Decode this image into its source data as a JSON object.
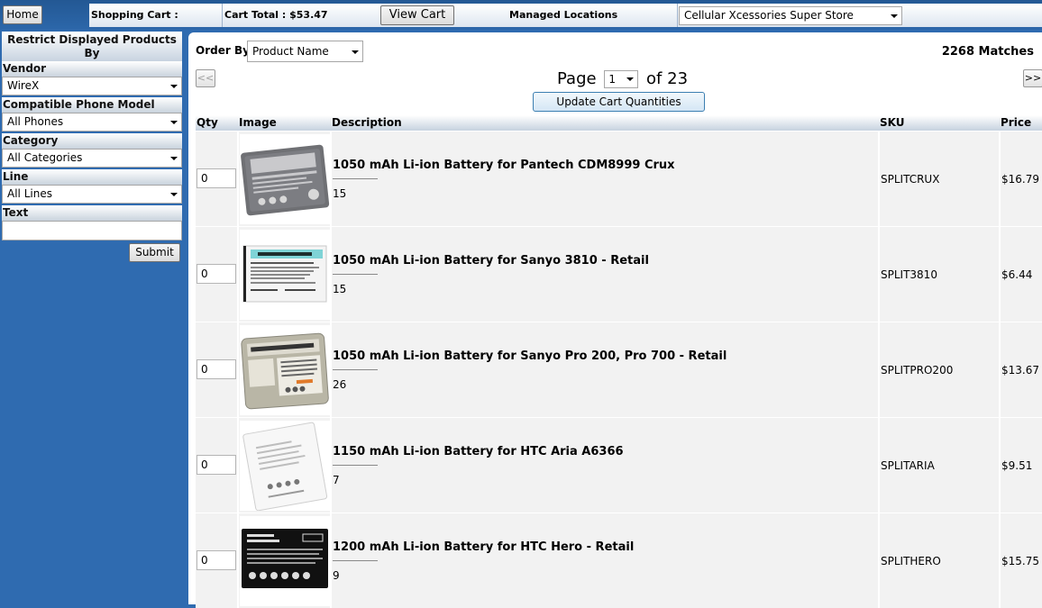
{
  "topbar": {
    "home_label": "Home",
    "shopping_cart_label": "Shopping Cart :",
    "cart_total_label": "Cart Total : $53.47",
    "view_cart_label": "View Cart",
    "managed_locations_label": "Managed Locations",
    "location_selected": "Cellular Xcessories Super Store"
  },
  "sidebar": {
    "title": "Restrict Displayed Products By",
    "filters": [
      {
        "label": "Vendor",
        "value": "WireX"
      },
      {
        "label": "Compatible Phone Model",
        "value": "All Phones"
      },
      {
        "label": "Category",
        "value": "All Categories"
      },
      {
        "label": "Line",
        "value": "All Lines"
      }
    ],
    "text_label": "Text",
    "text_value": "",
    "submit_label": "Submit"
  },
  "main": {
    "order_by_label": "Order By:",
    "order_by_value": "Product Name",
    "matches": "2268 Matches",
    "prev_label": "<<",
    "next_label": ">>",
    "page_label": "Page",
    "page_value": "1",
    "page_of": "of 23",
    "update_label": "Update Cart Quantities",
    "columns": [
      "Qty",
      "Image",
      "Description",
      "SKU",
      "Price"
    ],
    "rows": [
      {
        "qty": "0",
        "description": "1050 mAh Li-ion Battery for Pantech CDM8999 Crux",
        "stock": "15",
        "sku": "SPLITCRUX",
        "price": "$16.79"
      },
      {
        "qty": "0",
        "description": "1050 mAh Li-ion Battery for Sanyo 3810 - Retail",
        "stock": "15",
        "sku": "SPLIT3810",
        "price": "$6.44"
      },
      {
        "qty": "0",
        "description": "1050 mAh Li-ion Battery for Sanyo Pro 200, Pro 700 - Retail",
        "stock": "26",
        "sku": "SPLITPRO200",
        "price": "$13.67"
      },
      {
        "qty": "0",
        "description": "1150 mAh Li-ion Battery for HTC Aria A6366",
        "stock": "7",
        "sku": "SPLITARIA",
        "price": "$9.51"
      },
      {
        "qty": "0",
        "description": "1200 mAh Li-ion Battery for HTC Hero - Retail",
        "stock": "9",
        "sku": "SPLITHERO",
        "price": "$15.75"
      }
    ],
    "images": [
      {
        "icon": "battery-gray-image",
        "line1": "CELLULAR PHONE",
        "line2": "3.7V LI-ION BATTERY PACK"
      },
      {
        "icon": "battery-white-teal-image",
        "line1": "FOR SYO SCP-3810",
        "line2": "3.7V LI-ION 1050mAh"
      },
      {
        "icon": "battery-silver-image",
        "line1": "FOR SYO SCP-200/700",
        "line2": "Li-ion Battery 3.7V 1050mAh"
      },
      {
        "icon": "battery-white-image",
        "line1": "",
        "line2": ""
      },
      {
        "icon": "battery-black-image",
        "line1": "Replacement For",
        "line2": "TOUCH PRO II"
      }
    ]
  }
}
